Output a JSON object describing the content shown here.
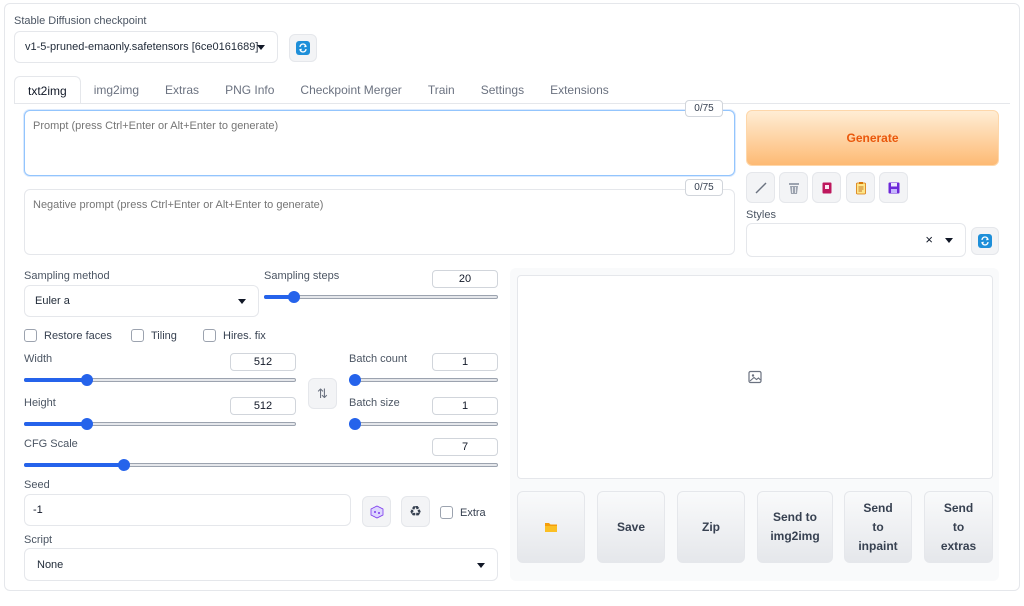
{
  "checkpoint": {
    "label": "Stable Diffusion checkpoint",
    "value": "v1-5-pruned-emaonly.safetensors [6ce0161689]"
  },
  "tabs": [
    {
      "label": "txt2img",
      "active": true
    },
    {
      "label": "img2img"
    },
    {
      "label": "Extras"
    },
    {
      "label": "PNG Info"
    },
    {
      "label": "Checkpoint Merger"
    },
    {
      "label": "Train"
    },
    {
      "label": "Settings"
    },
    {
      "label": "Extensions"
    }
  ],
  "prompt": {
    "placeholder": "Prompt (press Ctrl+Enter or Alt+Enter to generate)",
    "token_count": "0/75"
  },
  "negative_prompt": {
    "placeholder": "Negative prompt (press Ctrl+Enter or Alt+Enter to generate)",
    "token_count": "0/75"
  },
  "generate_label": "Generate",
  "tool_icons": [
    "pencil-icon",
    "trash-icon",
    "extra-networks-icon",
    "clipboard-icon",
    "save-style-icon"
  ],
  "styles": {
    "label": "Styles",
    "clear_glyph": "×"
  },
  "sampling_method": {
    "label": "Sampling method",
    "value": "Euler a"
  },
  "sampling_steps": {
    "label": "Sampling steps",
    "value": "20",
    "fraction": 0.13
  },
  "checkboxes": {
    "restore_faces": "Restore faces",
    "tiling": "Tiling",
    "hires_fix": "Hires. fix"
  },
  "width": {
    "label": "Width",
    "value": "512",
    "fraction": 0.23
  },
  "height": {
    "label": "Height",
    "value": "512",
    "fraction": 0.23
  },
  "batch_count": {
    "label": "Batch count",
    "value": "1",
    "fraction": 0.0
  },
  "batch_size": {
    "label": "Batch size",
    "value": "1",
    "fraction": 0.0
  },
  "cfg_scale": {
    "label": "CFG Scale",
    "value": "7",
    "fraction": 0.21
  },
  "swap_glyph": "⇅",
  "seed": {
    "label": "Seed",
    "value": "-1",
    "extra_label": "Extra",
    "recycle_glyph": "♻"
  },
  "script": {
    "label": "Script",
    "value": "None"
  },
  "actions": {
    "save": "Save",
    "zip": "Zip",
    "send_img2img": "Send to img2img",
    "send_inpaint": "Send to inpaint",
    "send_extras": "Send to extras"
  },
  "colors": {
    "accent": "#2563eb",
    "generate_text": "#ea580c",
    "refresh_icon": "#1e8fd9"
  }
}
